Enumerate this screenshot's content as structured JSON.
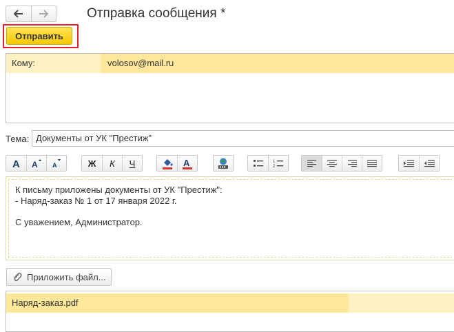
{
  "nav": {
    "back_icon": "arrow-left-icon",
    "forward_icon": "arrow-right-icon"
  },
  "window": {
    "title": "Отправка сообщения *"
  },
  "toolbar": {
    "send_label": "Отправить",
    "send_color": "#f5c800",
    "highlight_color": "#e2202a"
  },
  "recipients": {
    "label": "Кому:",
    "value": "volosov@mail.ru"
  },
  "subject": {
    "label": "Тема:",
    "value": "Документы от УК \"Престиж\""
  },
  "format_toolbar": {
    "font_group": [
      "font-size-icon",
      "increase-font-icon",
      "decrease-font-icon"
    ],
    "style_group": [
      {
        "icon": "bold-icon",
        "glyph": "Ж"
      },
      {
        "icon": "italic-icon",
        "glyph": "К"
      },
      {
        "icon": "underline-icon",
        "glyph": "Ч"
      }
    ],
    "color_group": [
      "fill-color-icon",
      "text-color-icon"
    ],
    "image_group": [
      "insert-image-icon"
    ],
    "list_group": [
      "bullet-list-icon",
      "numbered-list-icon"
    ],
    "align_group": [
      "align-left-icon",
      "align-center-icon",
      "align-right-icon",
      "align-justify-icon"
    ],
    "indent_group": [
      "indent-increase-icon",
      "indent-decrease-icon"
    ]
  },
  "message": {
    "lines": [
      "К письму приложены документы от УК \"Престиж\":",
      "- Наряд-заказ № 1 от 17 января 2022 г.",
      "",
      "С уважением, Администратор."
    ]
  },
  "attachments": {
    "attach_label": "Приложить файл...",
    "attach_icon": "paperclip-icon",
    "files": [
      "Наряд-заказ.pdf"
    ]
  }
}
